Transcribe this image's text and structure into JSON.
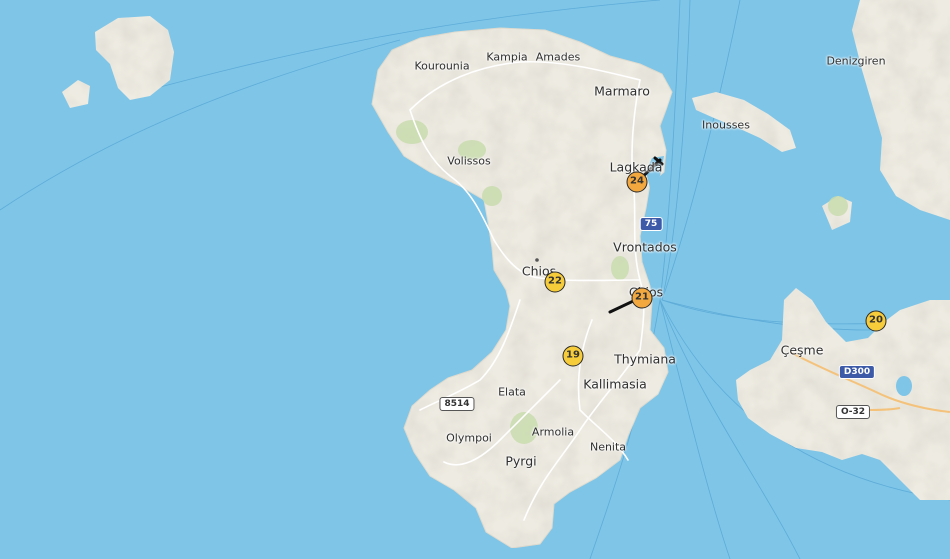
{
  "map": {
    "labels": [
      {
        "id": "kourounia",
        "text": "Kourounia"
      },
      {
        "id": "kampia",
        "text": "Kampia"
      },
      {
        "id": "amades",
        "text": "Amades"
      },
      {
        "id": "marmaro",
        "text": "Marmaro"
      },
      {
        "id": "volissos",
        "text": "Volissos"
      },
      {
        "id": "lagkada",
        "text": "Lagkada"
      },
      {
        "id": "vrontados",
        "text": "Vrontados"
      },
      {
        "id": "chios-town",
        "text": "Chios"
      },
      {
        "id": "chios",
        "text": "Chios"
      },
      {
        "id": "thymiana",
        "text": "Thymiana"
      },
      {
        "id": "kallimasia",
        "text": "Kallimasia"
      },
      {
        "id": "elata",
        "text": "Elata"
      },
      {
        "id": "olympoi",
        "text": "Olympoi"
      },
      {
        "id": "armolia",
        "text": "Armolia"
      },
      {
        "id": "nenita",
        "text": "Nenita"
      },
      {
        "id": "pyrgi",
        "text": "Pyrgi"
      },
      {
        "id": "inousses",
        "text": "Inousses"
      },
      {
        "id": "denizgiren",
        "text": "Denizgiren"
      },
      {
        "id": "cesme",
        "text": "Çeşme"
      }
    ],
    "road_shields": [
      {
        "id": "road-75",
        "text": "75",
        "style": "blue"
      },
      {
        "id": "road-d300",
        "text": "D300",
        "style": "blue"
      },
      {
        "id": "road-8514",
        "text": "8514",
        "style": "white"
      },
      {
        "id": "road-o32",
        "text": "O-32",
        "style": "white"
      }
    ],
    "markers": [
      {
        "id": "24",
        "label": "24",
        "color": "#f2a83e"
      },
      {
        "id": "22",
        "label": "22",
        "color": "#f6cc3b"
      },
      {
        "id": "21",
        "label": "21",
        "color": "#f2a83e"
      },
      {
        "id": "19",
        "label": "19",
        "color": "#f6cc3b"
      },
      {
        "id": "20",
        "label": "20",
        "color": "#f6cc3b"
      }
    ],
    "colors": {
      "sea": "#7ec5e8",
      "land": "#eeebe2",
      "forest": "#c9dcae",
      "road": "#ffffff",
      "route": "#f4c27a"
    }
  }
}
